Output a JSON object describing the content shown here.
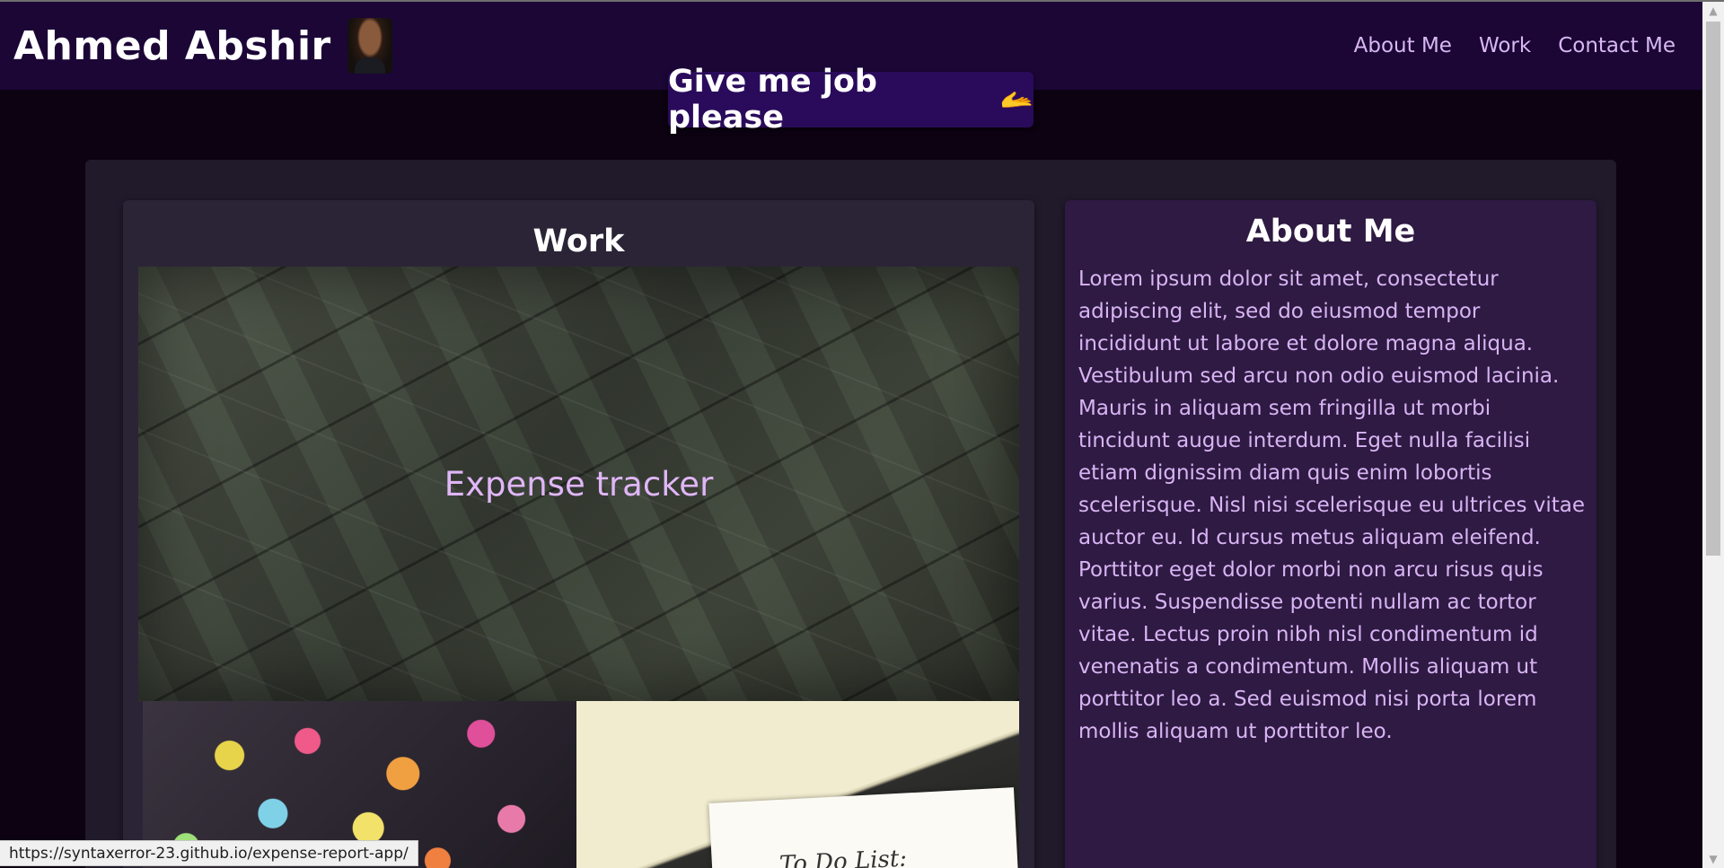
{
  "header": {
    "brand_name": "Ahmed Abshir",
    "avatar_icon": "profile-photo",
    "nav": [
      {
        "label": "About Me"
      },
      {
        "label": "Work"
      },
      {
        "label": "Contact Me"
      }
    ]
  },
  "hire_button": {
    "label": "Give me job please",
    "icon": "🫴"
  },
  "work": {
    "title": "Work",
    "featured_project": {
      "label": "Expense tracker"
    },
    "thumbnails": [
      {
        "name": "sticky-notes-project"
      },
      {
        "name": "todo-list-project",
        "text": "To Do List:"
      }
    ]
  },
  "about": {
    "title": "About Me",
    "body": "Lorem ipsum dolor sit amet, consectetur adipiscing elit, sed do eiusmod tempor incididunt ut labore et dolore magna aliqua. Vestibulum sed arcu non odio euismod lacinia. Mauris in aliquam sem fringilla ut morbi tincidunt augue interdum. Eget nulla facilisi etiam dignissim diam quis enim lobortis scelerisque. Nisl nisi scelerisque eu ultrices vitae auctor eu. Id cursus metus aliquam eleifend. Porttitor eget dolor morbi non arcu risus quis varius. Suspendisse potenti nullam ac tortor vitae. Lectus proin nibh nisl condimentum id venenatis a condimentum. Mollis aliquam ut porttitor leo a. Sed euismod nisi porta lorem mollis aliquam ut porttitor leo."
  },
  "status_bar": {
    "url": "https://syntaxerror-23.github.io/expense-report-app/"
  },
  "colors": {
    "page_background": "#0c0212",
    "navbar": "#1b0636",
    "accent_text": "#d8b4f4",
    "button": "#2a0b5b"
  }
}
